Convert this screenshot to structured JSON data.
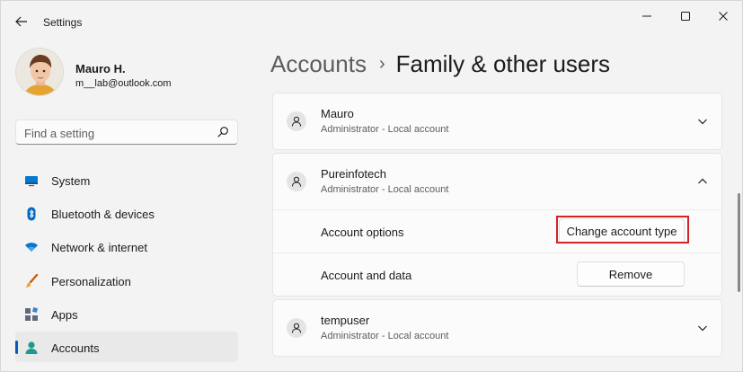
{
  "window": {
    "title": "Settings"
  },
  "profile": {
    "name": "Mauro H.",
    "email": "m__lab@outlook.com"
  },
  "search": {
    "placeholder": "Find a setting"
  },
  "nav": {
    "items": [
      {
        "label": "System",
        "icon": "monitor-icon"
      },
      {
        "label": "Bluetooth & devices",
        "icon": "bluetooth-icon"
      },
      {
        "label": "Network & internet",
        "icon": "wifi-icon"
      },
      {
        "label": "Personalization",
        "icon": "brush-icon"
      },
      {
        "label": "Apps",
        "icon": "apps-icon"
      },
      {
        "label": "Accounts",
        "icon": "person-icon",
        "selected": true
      }
    ]
  },
  "breadcrumb": {
    "parent": "Accounts",
    "separator": "›",
    "current": "Family & other users"
  },
  "accounts": [
    {
      "name": "Mauro",
      "type": "Administrator - Local account",
      "expanded": false
    },
    {
      "name": "Pureinfotech",
      "type": "Administrator - Local account",
      "expanded": true,
      "options": [
        {
          "label": "Account options",
          "button": "Change account type"
        },
        {
          "label": "Account and data",
          "button": "Remove"
        }
      ]
    },
    {
      "name": "tempuser",
      "type": "Administrator - Local account",
      "expanded": false
    }
  ],
  "colors": {
    "accent": "#005fb8",
    "highlight": "#d3232a",
    "background": "#f3f3f3",
    "card": "#fbfbfb"
  }
}
